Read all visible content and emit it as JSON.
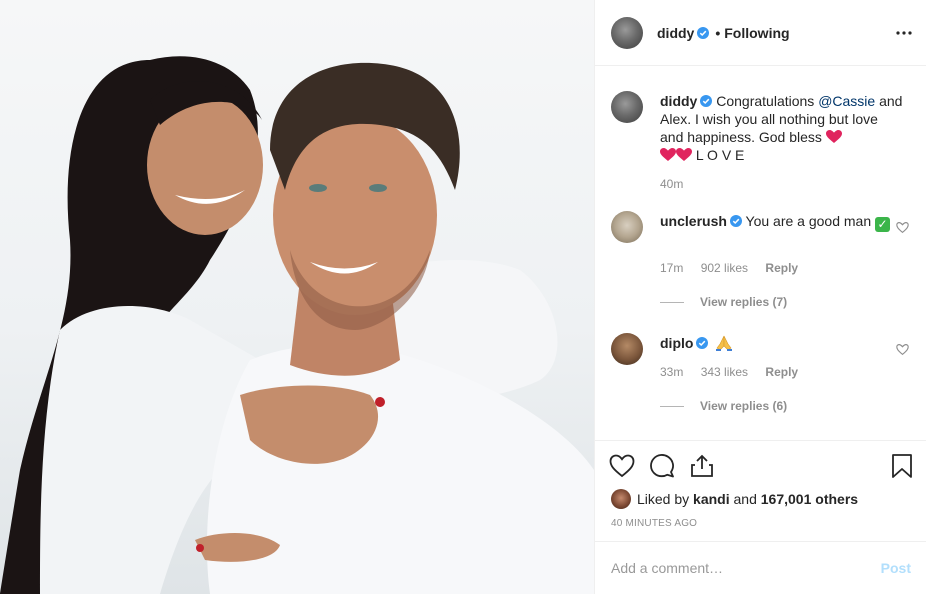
{
  "header": {
    "username": "diddy",
    "separator": "•",
    "follow_status": "Following"
  },
  "caption": {
    "username": "diddy",
    "text_before": "Congratulations",
    "mention": "@Cassie",
    "text_after": "and Alex. I wish you all nothing but love and happiness. God bless",
    "emoji_line": "L O V E",
    "time": "40m"
  },
  "comments": [
    {
      "username": "unclerush",
      "text": "You are a good man",
      "time": "17m",
      "likes": "902 likes",
      "reply": "Reply",
      "view_replies": "View replies (7)"
    },
    {
      "username": "diplo",
      "text": "",
      "time": "33m",
      "likes": "343 likes",
      "reply": "Reply",
      "view_replies": "View replies (6)"
    }
  ],
  "actions": {
    "liked_by_prefix": "Liked by",
    "liked_by_user": "kandi",
    "liked_by_middle": "and",
    "liked_by_others": "167,001 others",
    "timestamp": "40 MINUTES AGO"
  },
  "add_comment": {
    "placeholder": "Add a comment…",
    "post_label": "Post"
  },
  "colors": {
    "verified_blue": "#3897f0",
    "link_blue": "#003569",
    "post_disabled": "#b2dffc",
    "heart_red": "#e0245e",
    "secondary_text": "#8e8e8e"
  },
  "icons": [
    "verified-badge-icon",
    "more-options-icon",
    "heart-icon",
    "comment-icon",
    "share-icon",
    "bookmark-icon",
    "praying-hands-emoji",
    "check-mark-emoji",
    "red-heart-emoji"
  ]
}
